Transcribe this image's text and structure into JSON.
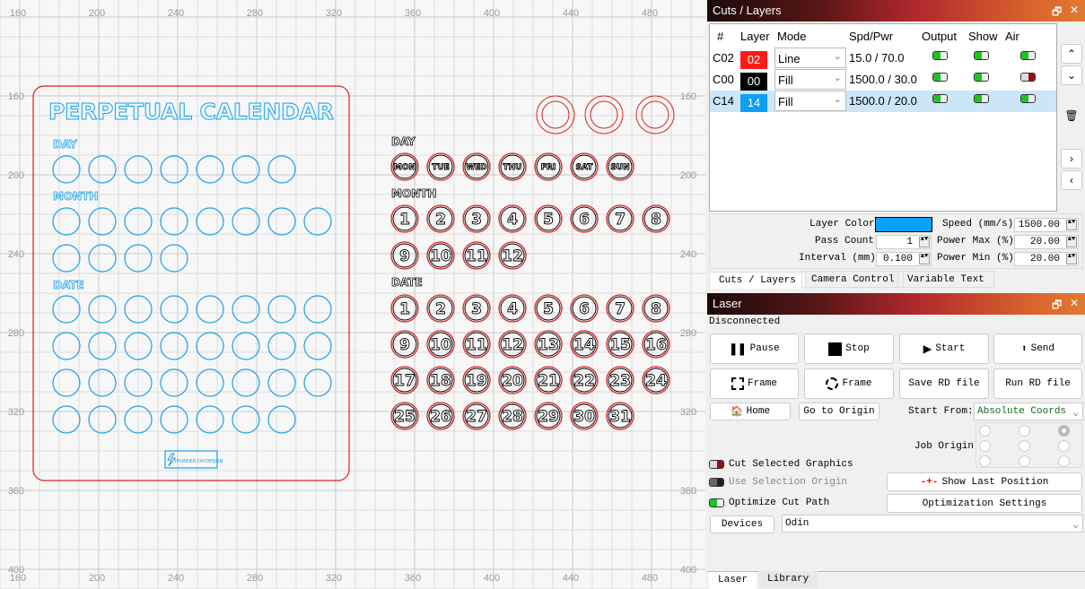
{
  "canvas": {
    "ruler_top": [
      "160",
      "200",
      "240",
      "280",
      "320",
      "360",
      "400",
      "440",
      "480"
    ],
    "ruler_left": [
      "160",
      "200",
      "240",
      "280",
      "320",
      "360",
      "400"
    ],
    "ruler_bottom": [
      "160",
      "200",
      "240",
      "280",
      "320",
      "360",
      "400",
      "440",
      "480"
    ],
    "ruler_right": [
      "160",
      "200",
      "240",
      "280",
      "320",
      "360",
      "400"
    ],
    "design_title": "PERPETUAL CALENDAR",
    "left_labels": [
      "DAY",
      "MONTH",
      "DATE"
    ],
    "right_labels": [
      "DAY",
      "MONTH",
      "DATE"
    ],
    "days": [
      "MON",
      "TUE",
      "WED",
      "THU",
      "FRI",
      "SAT",
      "SUN"
    ],
    "months": [
      "1",
      "2",
      "3",
      "4",
      "5",
      "6",
      "7",
      "8",
      "9",
      "10",
      "11",
      "12"
    ],
    "dates": [
      "1",
      "2",
      "3",
      "4",
      "5",
      "6",
      "7",
      "8",
      "9",
      "10",
      "11",
      "12",
      "13",
      "14",
      "15",
      "16",
      "17",
      "18",
      "19",
      "20",
      "21",
      "22",
      "23",
      "24",
      "25",
      "26",
      "27",
      "28",
      "29",
      "30",
      "31"
    ],
    "logo_text": "THUNDER DIY.DESIGN",
    "colors": {
      "blue": "#1aa0e8",
      "red": "#e02020",
      "grid": "#dcdcdc"
    }
  },
  "cuts": {
    "title": "Cuts / Layers",
    "headers": [
      "#",
      "Layer",
      "Mode",
      "Spd/Pwr",
      "Output",
      "Show",
      "Air"
    ],
    "rows": [
      {
        "id": "C02",
        "layer": "02",
        "color": "#ff1a1a",
        "mode": "Line",
        "spdpwr": "15.0 / 70.0",
        "output": true,
        "show": true,
        "air": true
      },
      {
        "id": "C00",
        "layer": "00",
        "color": "#000000",
        "mode": "Fill",
        "spdpwr": "1500.0 / 30.0",
        "output": true,
        "show": true,
        "air": false
      },
      {
        "id": "C14",
        "layer": "14",
        "color": "#0aa0f5",
        "mode": "Fill",
        "spdpwr": "1500.0 / 20.0",
        "output": true,
        "show": true,
        "air": true,
        "selected": true
      }
    ],
    "settings": {
      "layer_color_label": "Layer Color",
      "layer_color": "#0aa0f5",
      "pass_count_label": "Pass Count",
      "pass_count": "1",
      "interval_label": "Interval (mm)",
      "interval": "0.100",
      "speed_label": "Speed (mm/s)",
      "speed": "1500.00",
      "power_max_label": "Power Max (%)",
      "power_max": "20.00",
      "power_min_label": "Power Min (%)",
      "power_min": "20.00"
    },
    "tabs": [
      "Cuts / Layers",
      "Camera Control",
      "Variable Text"
    ]
  },
  "laser": {
    "title": "Laser",
    "status": "Disconnected",
    "buttons": {
      "pause": "Pause",
      "stop": "Stop",
      "start": "Start",
      "send": "Send",
      "frame1": "Frame",
      "frame2": "Frame",
      "save_rd": "Save RD file",
      "run_rd": "Run RD file",
      "home": "Home",
      "go_origin": "Go to Origin",
      "show_last": "Show Last Position",
      "opt_settings": "Optimization Settings",
      "devices": "Devices"
    },
    "start_from_label": "Start From:",
    "start_from": "Absolute Coords",
    "job_origin_label": "Job Origin",
    "job_origin_selected": "top-right",
    "cut_selected": {
      "label": "Cut Selected Graphics",
      "on": false
    },
    "use_selection_origin": {
      "label": "Use Selection Origin",
      "on": false
    },
    "optimize_cut_path": {
      "label": "Optimize Cut Path",
      "on": true
    },
    "device": "Odin",
    "tabs": [
      "Laser",
      "Library"
    ]
  }
}
